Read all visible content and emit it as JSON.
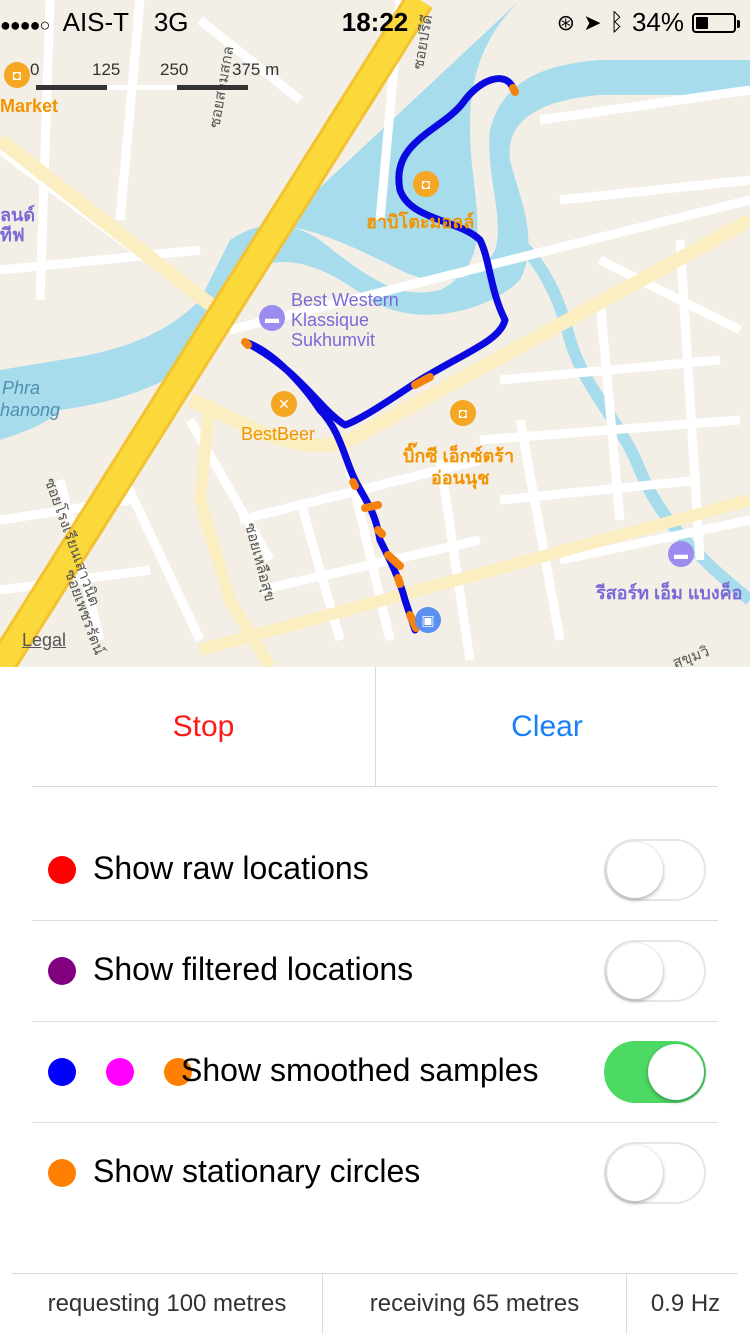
{
  "status_bar": {
    "signal": "●●●●○",
    "carrier": "AIS-T",
    "network": "3G",
    "time": "18:22",
    "battery_percent": "34%",
    "battery_level": 0.34
  },
  "map": {
    "scale": {
      "labels": [
        "0",
        "125",
        "250",
        "375 m"
      ]
    },
    "labels": {
      "market": "Market",
      "left_fragment_1": "ลนด์",
      "left_fragment_2": "ทีฟ",
      "habito": "ฮาบิโตะมอลล์",
      "best_western_1": "Best Western",
      "best_western_2": "Klassique",
      "best_western_3": "Sukhumvit",
      "phra_1": "Phra",
      "phra_2": "hanong",
      "bestbeer": "BestBeer",
      "bigc_1": "บิ๊กซี เอ็กซ์ตร้า",
      "bigc_2": "อ่อนนุช",
      "resort": "รีสอร์ท เอ็ม แบงค็อ",
      "soi_1": "ซอยปรีดี",
      "soi_2": "ซอยสามสกล",
      "soi_3": "ซอยโรงเรียนเสาวนิต",
      "soi_4": "ซอยเพชรรัตน์",
      "soi_5": "ซอยเหลือสุข",
      "soi_6": "สุขุมวิ"
    },
    "legal": "Legal",
    "colors": {
      "track": "#0a0ae0",
      "stationary": "#f5820f",
      "road_major": "#fcd93b",
      "water": "#a7dcec",
      "poi_orange": "#f5a623",
      "poi_purple": "#9b8df0"
    }
  },
  "controls": {
    "stop_label": "Stop",
    "clear_label": "Clear"
  },
  "settings": [
    {
      "label": "Show raw locations",
      "dots": [
        "#ff0000"
      ],
      "enabled": false
    },
    {
      "label": "Show filtered locations",
      "dots": [
        "#800080"
      ],
      "enabled": false
    },
    {
      "label": "Show smoothed samples",
      "dots": [
        "#0000ff",
        "#ff00ff",
        "#ff7f00"
      ],
      "enabled": true
    },
    {
      "label": "Show stationary circles",
      "dots": [
        "#ff7f00"
      ],
      "enabled": false
    }
  ],
  "footer": {
    "requesting": "requesting 100 metres",
    "receiving": "receiving 65 metres",
    "frequency": "0.9 Hz"
  }
}
